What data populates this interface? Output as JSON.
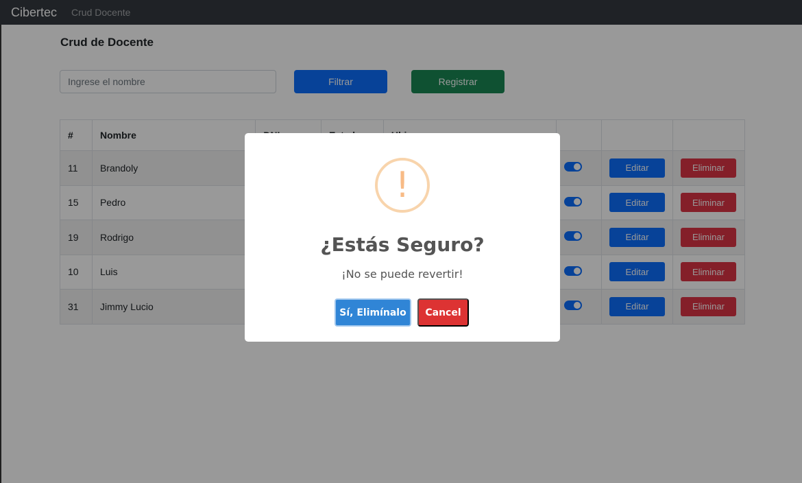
{
  "navbar": {
    "brand": "Cibertec",
    "link": "Crud Docente"
  },
  "page": {
    "title": "Crud de Docente",
    "search_placeholder": "Ingrese el nombre",
    "filter_label": "Filtrar",
    "register_label": "Registrar"
  },
  "table": {
    "headers": [
      "#",
      "Nombre",
      "DNI",
      "Estado",
      "Ubigeo",
      "",
      "",
      ""
    ],
    "rows": [
      {
        "id": "11",
        "nombre": "Brandoly",
        "edit": "Editar",
        "delete": "Eliminar"
      },
      {
        "id": "15",
        "nombre": "Pedro",
        "edit": "Editar",
        "delete": "Eliminar"
      },
      {
        "id": "19",
        "nombre": "Rodrigo",
        "edit": "Editar",
        "delete": "Eliminar"
      },
      {
        "id": "10",
        "nombre": "Luis",
        "edit": "Editar",
        "delete": "Eliminar"
      },
      {
        "id": "31",
        "nombre": "Jimmy Lucio",
        "edit": "Editar",
        "delete": "Eliminar"
      }
    ]
  },
  "dialog": {
    "icon": "warning-icon",
    "icon_glyph": "!",
    "title": "¿Estás Seguro?",
    "text": "¡No se puede revertir!",
    "confirm_label": "Sí, Elimínalo",
    "cancel_label": "Cancel"
  },
  "colors": {
    "navbar": "#343a40",
    "primary": "#0d6efd",
    "success": "#198754",
    "danger": "#dc3545",
    "dialog_confirm": "#3085d6",
    "dialog_cancel": "#dd3333",
    "warning": "#f8bb86"
  }
}
